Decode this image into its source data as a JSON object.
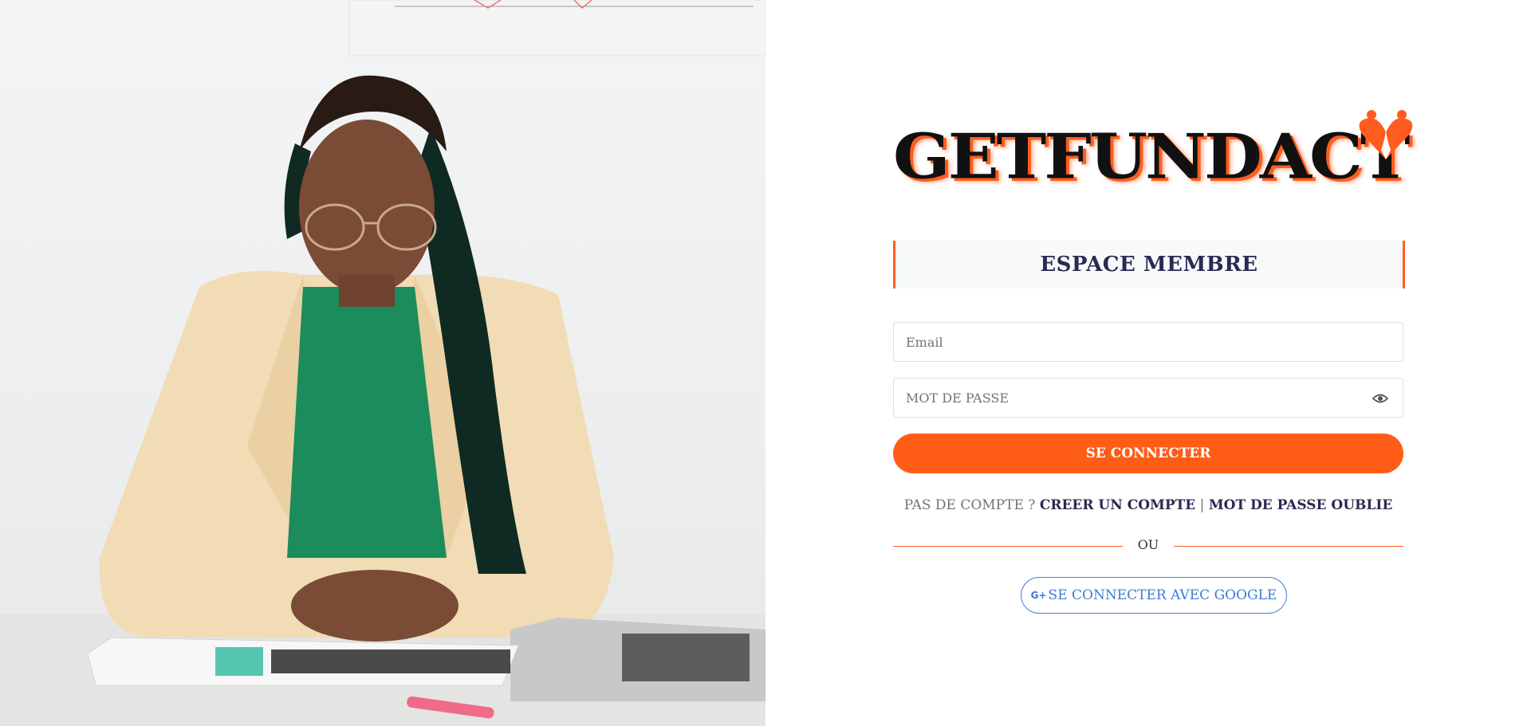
{
  "brand": {
    "logo_text": "GETFUNDACT",
    "accent_color": "#ff5d1f",
    "dark_color": "#2a2a52"
  },
  "login": {
    "title": "ESPACE MEMBRE",
    "email_placeholder": "Email",
    "password_placeholder": "MOT DE PASSE",
    "password_toggle_icon": "eye-icon",
    "submit_label": "SE CONNECTER",
    "no_account_text": "PAS DE COMPTE ?",
    "create_account_label": "CREER UN COMPTE",
    "link_separator": "|",
    "forgot_password_label": "MOT DE PASSE OUBLIE",
    "divider_label": "OU",
    "google_icon": "google-g-icon",
    "google_icon_text": "G+",
    "google_label": "SE CONNECTER AVEC GOOGLE"
  },
  "hero": {
    "image_subject": "woman-at-desk-photo"
  }
}
